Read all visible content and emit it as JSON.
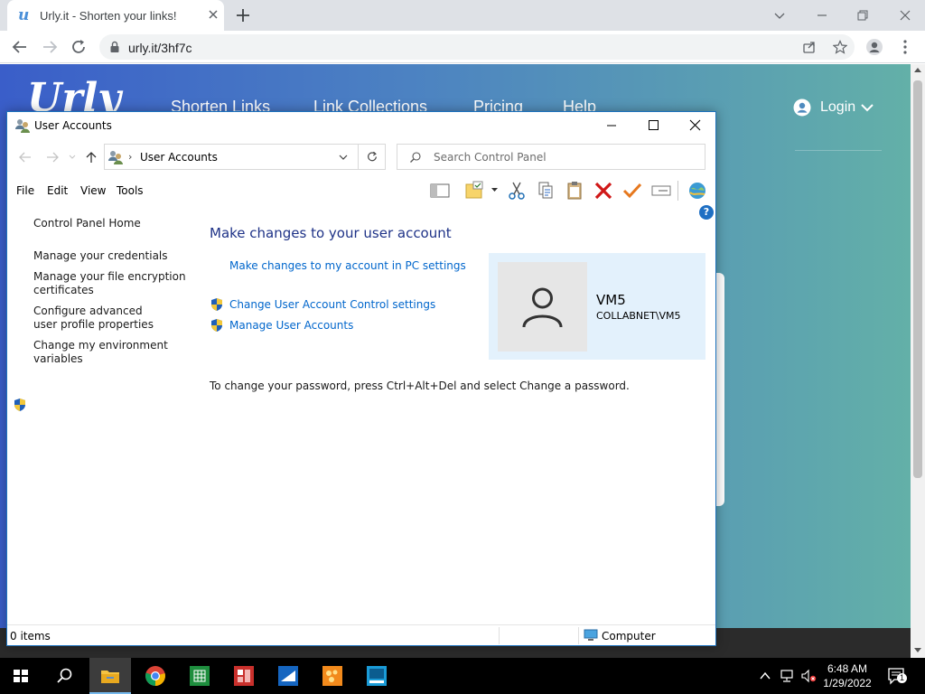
{
  "browser": {
    "tab_title": "Urly.it - Shorten your links!",
    "tab_favicon_letter": "u",
    "url": "urly.it/3hf7c"
  },
  "website": {
    "logo": "Urly",
    "nav": [
      "Shorten Links",
      "Link Collections",
      "Pricing",
      "Help"
    ],
    "login_label": "Login"
  },
  "window": {
    "title": "User Accounts",
    "address_path": "User Accounts",
    "search_placeholder": "Search Control Panel",
    "menu": [
      "File",
      "Edit",
      "View",
      "Tools"
    ],
    "left_pane": [
      "Control Panel Home",
      "Manage your credentials",
      "Manage your file encryption certificates",
      "Configure advanced user profile properties",
      "Change my environment variables"
    ],
    "heading": "Make changes to your user account",
    "links": {
      "pc_settings": "Make changes to my account in PC settings",
      "uac": "Change User Account Control settings",
      "manage": "Manage User Accounts"
    },
    "password_note": "To change your password, press Ctrl+Alt+Del and select Change a password.",
    "user": {
      "name": "VM5",
      "domain": "COLLABNET\\VM5"
    },
    "status": {
      "items": "0 items",
      "location": "Computer"
    }
  },
  "taskbar": {
    "time": "6:48 AM",
    "date": "1/29/2022",
    "notification_count": "1",
    "apps": [
      "start-icon",
      "search-icon",
      "file-explorer-icon",
      "chrome-icon",
      "spreadsheet-icon",
      "app-red-icon",
      "mail-icon",
      "paint-icon",
      "app-blue-icon"
    ]
  },
  "colors": {
    "link": "#0066cc",
    "heading": "#1e3287",
    "window_border": "#1e73be",
    "user_card": "#e3f1fc",
    "page_gradient_start": "#3a5ec9",
    "page_gradient_end": "#63b0a8"
  }
}
